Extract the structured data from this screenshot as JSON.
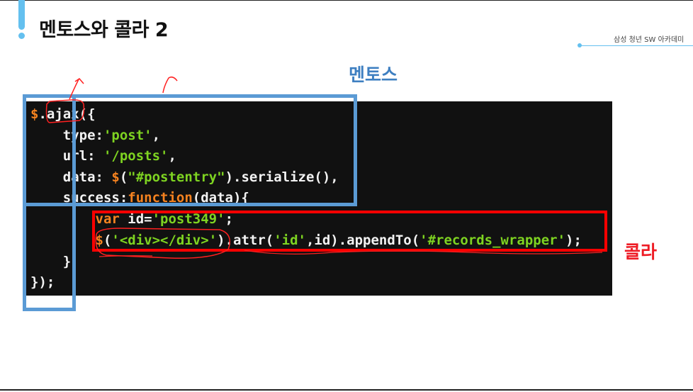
{
  "slide": {
    "title": "멘토스와 콜라 2",
    "brand": "삼성 청년 SW 아카데미"
  },
  "labels": {
    "mentos": "멘토스",
    "cola": "콜라"
  },
  "code": {
    "line1_dollar": "$",
    "line1_rest": ".ajax({",
    "line2_key": "    type:",
    "line2_val": "'post'",
    "line2_end": ",",
    "line3_key": "    url: ",
    "line3_val": "'/posts'",
    "line3_end": ",",
    "line4_key": "    data: ",
    "line4_dollar": "$",
    "line4_paren": "(",
    "line4_str": "\"#postentry\"",
    "line4_end": ").serialize(),",
    "line5_key": "    success:",
    "line5_fn": "function",
    "line5_end": "(data){",
    "line6_indent": "        ",
    "line6_var": "var",
    "line6_id": " id=",
    "line6_str": "'post349'",
    "line6_end": ";",
    "line7_indent": "        ",
    "line7_dollar": "$",
    "line7_paren": "(",
    "line7_str": "'<div></div>'",
    "line7_mid": ").attr(",
    "line7_id_str": "'id'",
    "line7_mid2": ",id).appendTo(",
    "line7_sel": "'#records_wrapper'",
    "line7_end": ");",
    "line8": "    }",
    "line9": "});"
  },
  "colors": {
    "accent": "#64c0ef",
    "mentos_blue": "#5b9bd5",
    "cola_red": "#ff0000",
    "code_bg": "#111111",
    "code_orange": "#f5821f",
    "code_green": "#7ed321"
  }
}
